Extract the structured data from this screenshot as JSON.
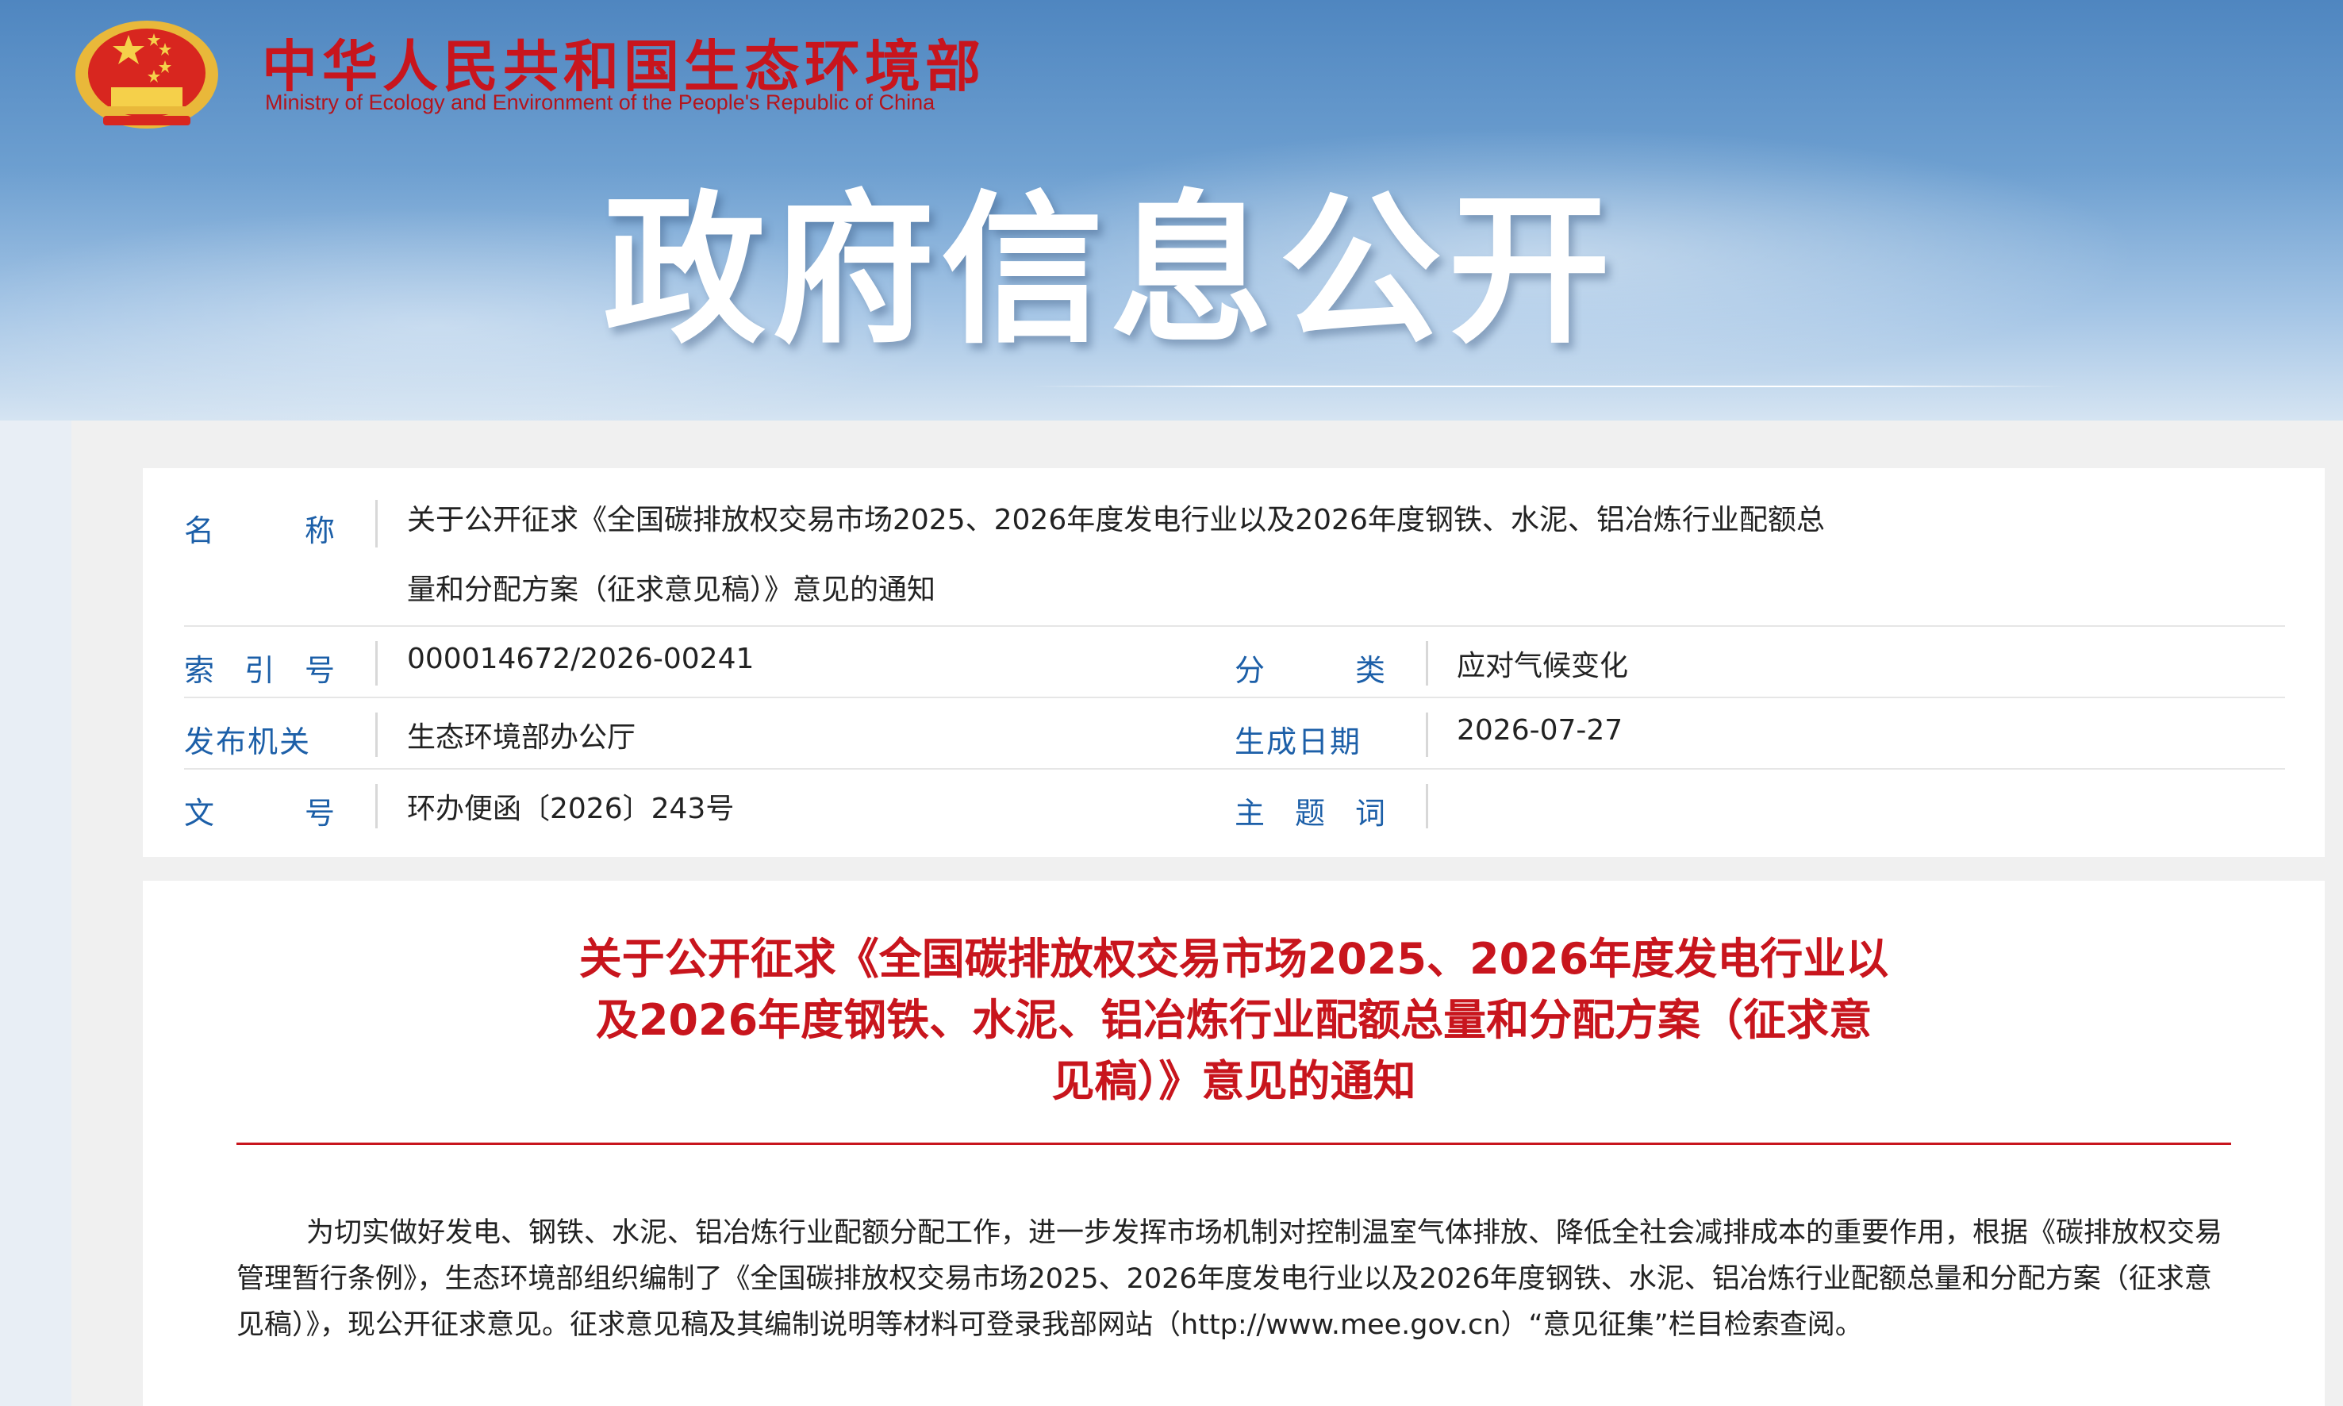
{
  "header": {
    "ministry_cn": "中华人民共和国生态环境部",
    "ministry_en": "Ministry of Ecology and Environment of the People's Republic of China",
    "section_title": "政府信息公开"
  },
  "meta": {
    "name_label": [
      "名",
      "称"
    ],
    "name_value_line1": "关于公开征求《全国碳排放权交易市场2025、2026年度发电行业以及2026年度钢铁、水泥、铝冶炼行业配额总",
    "name_value_line2": "量和分配方案（征求意见稿）》意见的通知",
    "index_label": [
      "索",
      "引",
      "号"
    ],
    "index_value": "000014672/2026-00241",
    "category_label": [
      "分",
      "类"
    ],
    "category_value": "应对气候变化",
    "issuer_label": "发布机关",
    "issuer_value": "生态环境部办公厅",
    "date_label": "生成日期",
    "date_value": "2026-07-27",
    "doc_no_label": [
      "文",
      "号"
    ],
    "doc_no_value": "环办便函〔2026〕243号",
    "keywords_label": [
      "主",
      "题",
      "词"
    ],
    "keywords_value": ""
  },
  "article": {
    "title_line1": "关于公开征求《全国碳排放权交易市场2025、2026年度发电行业以",
    "title_line2": "及2026年度钢铁、水泥、铝冶炼行业配额总量和分配方案（征求意",
    "title_line3": "见稿）》意见的通知",
    "body": "为切实做好发电、钢铁、水泥、铝冶炼行业配额分配工作，进一步发挥市场机制对控制温室气体排放、降低全社会减排成本的重要作用，根据《碳排放权交易管理暂行条例》，生态环境部组织编制了《全国碳排放权交易市场2025、2026年度发电行业以及2026年度钢铁、水泥、铝冶炼行业配额总量和分配方案（征求意见稿）》，现公开征求意见。征求意见稿及其编制说明等材料可登录我部网站（http://www.mee.gov.cn）“意见征集”栏目检索查阅。"
  },
  "colors": {
    "brand_red": "#c8151d",
    "label_blue": "#1c5fa8",
    "banner_blue": "#4f86c0"
  }
}
